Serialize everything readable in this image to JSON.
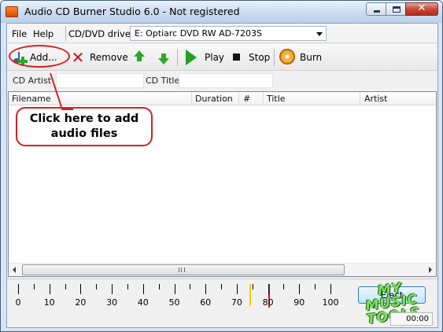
{
  "window": {
    "title": "Audio CD Burner Studio 6.0 - Not registered",
    "controls": {
      "minimize": "",
      "maximize": "",
      "close": "✕"
    }
  },
  "menu": {
    "file": "File",
    "help": "Help",
    "drives_label": "CD/DVD drives",
    "drive_value": "E: Optiarc DVD RW AD-7203S"
  },
  "toolbar": {
    "add": "Add...",
    "remove": "Remove",
    "play": "Play",
    "stop": "Stop",
    "burn": "Burn"
  },
  "fields": {
    "cd_artist_label": "CD Artist",
    "cd_artist_value": "",
    "cd_title_label": "CD Title",
    "cd_title_value": ""
  },
  "list": {
    "columns": [
      "Filename",
      "Duration",
      "#",
      "Title",
      "Artist"
    ],
    "rows": []
  },
  "callout": {
    "line1": "Click here to add",
    "line2": "audio files"
  },
  "scale": {
    "labels": [
      "0",
      "10",
      "20",
      "30",
      "40",
      "50",
      "60",
      "70",
      "80",
      "90",
      "100"
    ],
    "yellow_marker": 74,
    "red_marker": 80
  },
  "bottom": {
    "eject": "Eject",
    "time": "00:00"
  },
  "watermark": {
    "line1": "MY",
    "line2": "MUSIC",
    "line3": "TOOLS"
  },
  "colors": {
    "accent_red": "#d42121",
    "marker_yellow": "#f0d000",
    "marker_red": "#d71010",
    "play_green": "#22a022"
  }
}
